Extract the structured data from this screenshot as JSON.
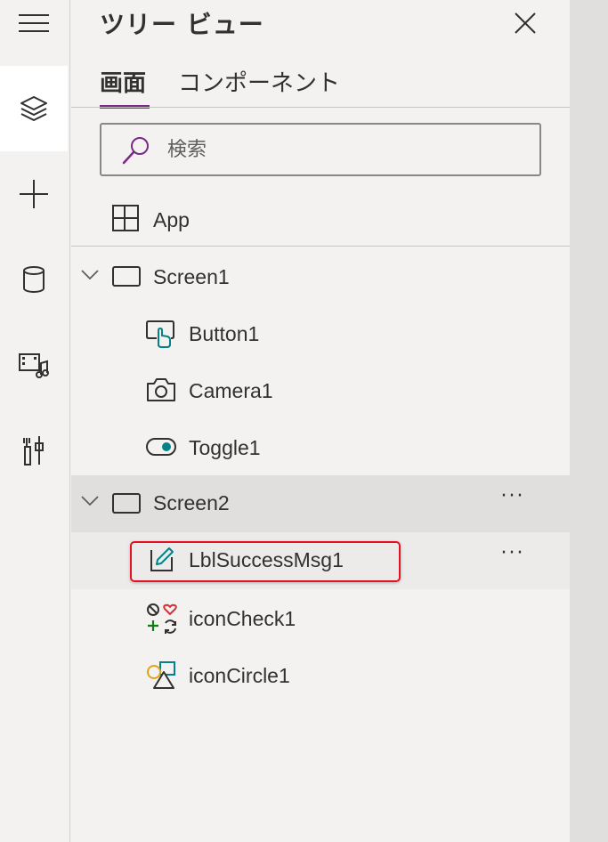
{
  "panel": {
    "title": "ツリー ビュー",
    "tabs": [
      {
        "label": "画面",
        "active": true
      },
      {
        "label": "コンポーネント",
        "active": false
      }
    ],
    "search": {
      "placeholder": "検索",
      "value": ""
    },
    "app_item": {
      "label": "App",
      "icon": "app-grid-icon"
    },
    "tree": [
      {
        "label": "Screen1",
        "icon": "screen-icon",
        "expanded": true
      },
      {
        "label": "Button1",
        "icon": "button-icon"
      },
      {
        "label": "Camera1",
        "icon": "camera-icon"
      },
      {
        "label": "Toggle1",
        "icon": "toggle-icon"
      },
      {
        "label": "Screen2",
        "icon": "screen-icon",
        "expanded": true,
        "selected": true,
        "more": "···"
      },
      {
        "label": "LblSuccessMsg1",
        "icon": "label-edit-icon",
        "hovered": true,
        "more": "···"
      },
      {
        "label": "iconCheck1",
        "icon": "icons-group-icon"
      },
      {
        "label": "iconCircle1",
        "icon": "shapes-icon"
      }
    ]
  },
  "rail": {
    "items": [
      {
        "icon": "hamburger-menu-icon"
      },
      {
        "icon": "layers-icon",
        "active": true
      },
      {
        "icon": "plus-icon"
      },
      {
        "icon": "database-icon"
      },
      {
        "icon": "media-icon"
      },
      {
        "icon": "tools-icon"
      }
    ]
  },
  "colors": {
    "accent": "#7a2a86",
    "highlight_border": "#e81123",
    "teal_icon": "#038387"
  }
}
